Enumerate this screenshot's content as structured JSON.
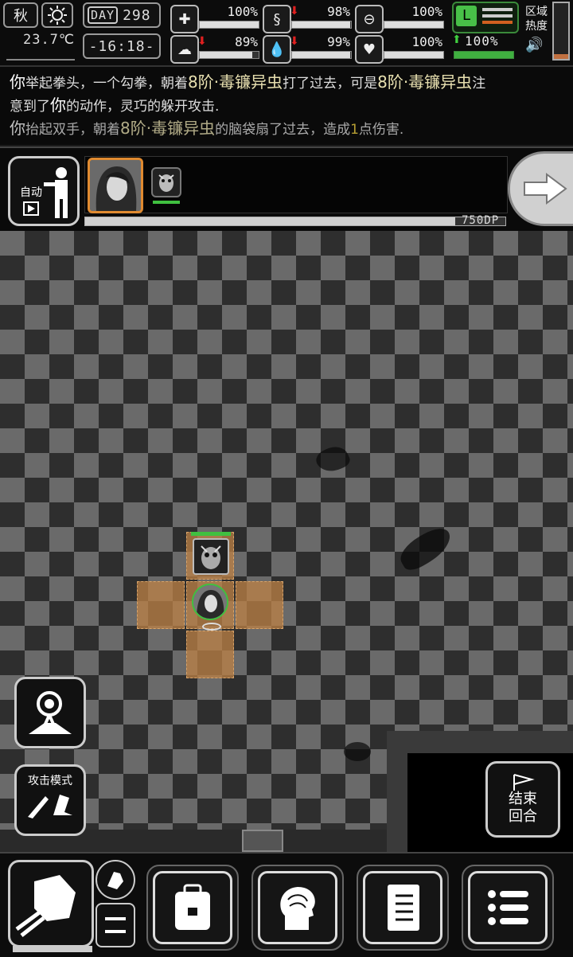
{
  "status": {
    "season": "秋",
    "weather_icon": "sun-icon",
    "temperature": "23.7℃",
    "day_label": "DAY",
    "day_value": "298",
    "time": "-16:18-",
    "stats": [
      {
        "name": "health",
        "icon": "medkit-icon",
        "value": "100%",
        "level": 100,
        "trend": ""
      },
      {
        "name": "hunger",
        "icon": "stomach-icon",
        "value": "98%",
        "level": 98,
        "trend": "down"
      },
      {
        "name": "stamina",
        "icon": "pill-icon",
        "value": "100%",
        "level": 100,
        "trend": ""
      },
      {
        "name": "sanity",
        "icon": "brain-icon",
        "value": "89%",
        "level": 89,
        "trend": "down"
      },
      {
        "name": "thirst",
        "icon": "water-drop-icon",
        "value": "99%",
        "level": 99,
        "trend": "down"
      },
      {
        "name": "mood",
        "icon": "heart-icon",
        "value": "100%",
        "level": 100,
        "trend": ""
      },
      {
        "name": "energy",
        "icon": "boot-icon",
        "value": "100%",
        "level": 100,
        "trend": "up"
      }
    ],
    "zone_heat_label": "区域\n热度",
    "zone_heat_line1": "区域",
    "zone_heat_line2": "热度"
  },
  "log": {
    "line1_a": "你",
    "line1_b": "举起拳头，一个勾拳，朝着",
    "line1_c": "8阶·毒镰异虫",
    "line1_d": "打了过去，可是",
    "line1_e": "8阶·毒镰异虫",
    "line1_f": "注",
    "line2_a": "意到了",
    "line2_b": "你",
    "line2_c": "的动作，灵巧的躲开攻击.",
    "line3_a": "你",
    "line3_b": "抬起双手，朝着",
    "line3_c": "8阶·毒镰异虫",
    "line3_d": "的脑袋扇了过去，造成",
    "line3_e": "1",
    "line3_f": "点伤害."
  },
  "battle": {
    "auto_label": "自动",
    "ap_text": "750DP",
    "ap_level": 92
  },
  "map": {
    "attack_mode_label": "攻击模式",
    "end_turn_line1": "结束",
    "end_turn_line2": "回合"
  },
  "toolbar": {
    "items": [
      "fist-icon",
      "backpack-icon",
      "brain-head-icon",
      "journal-icon",
      "menu-icon"
    ]
  }
}
